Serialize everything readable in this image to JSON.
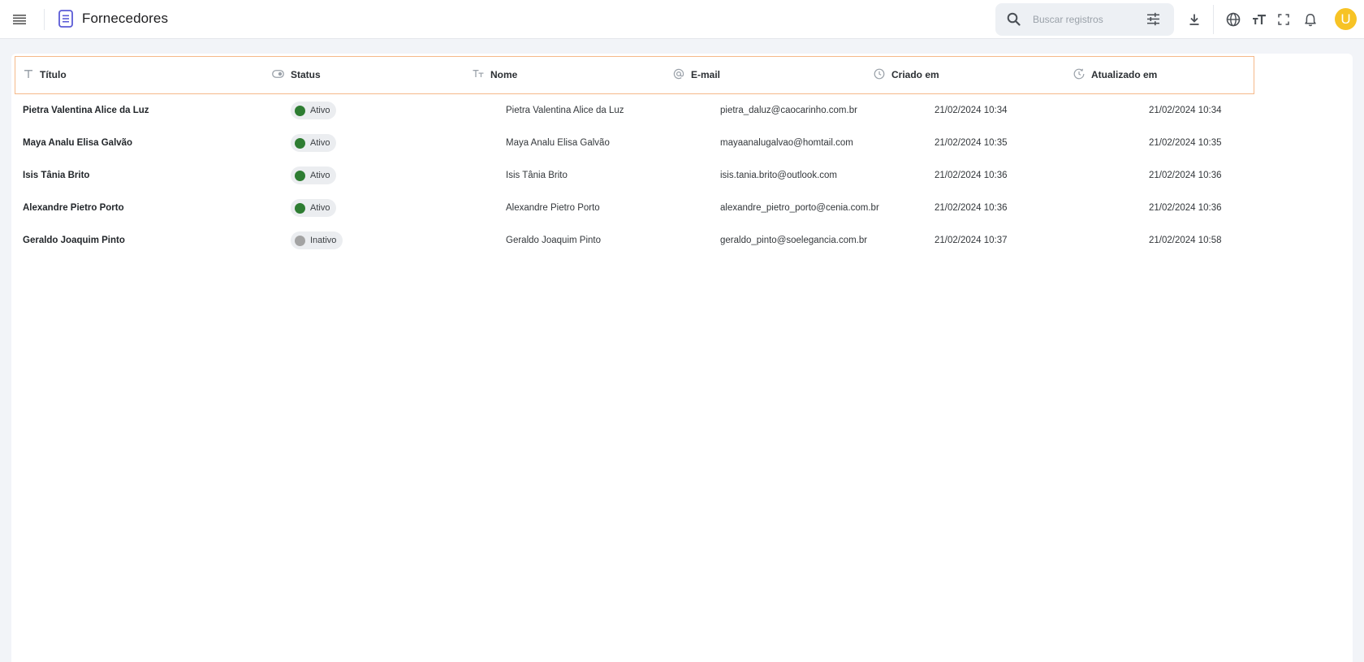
{
  "app": {
    "title": "Fornecedores"
  },
  "search": {
    "placeholder": "Buscar registros"
  },
  "user": {
    "avatar_initial": "U",
    "avatar_color": "#f7c325"
  },
  "toolbar_icons": [
    "menu-icon",
    "document-icon",
    "search-icon",
    "filter-sliders-icon",
    "download-icon",
    "globe-icon",
    "text-size-icon",
    "fullscreen-icon",
    "bell-icon"
  ],
  "table": {
    "columns": [
      {
        "label": "Título",
        "icon": "text-icon"
      },
      {
        "label": "Status",
        "icon": "toggle-icon"
      },
      {
        "label": "Nome",
        "icon": "text-size-icon"
      },
      {
        "label": "E-mail",
        "icon": "at-icon"
      },
      {
        "label": "Criado em",
        "icon": "clock-icon"
      },
      {
        "label": "Atualizado em",
        "icon": "clock-refresh-icon"
      }
    ],
    "rows": [
      {
        "titulo": "Pietra Valentina Alice da Luz",
        "status": "Ativo",
        "nome": "Pietra Valentina Alice da Luz",
        "email": "pietra_daluz@caocarinho.com.br",
        "criado": "21/02/2024 10:34",
        "atualizado": "21/02/2024 10:34"
      },
      {
        "titulo": "Maya Analu Elisa Galvão",
        "status": "Ativo",
        "nome": "Maya Analu Elisa Galvão",
        "email": "mayaanalugalvao@homtail.com",
        "criado": "21/02/2024 10:35",
        "atualizado": "21/02/2024 10:35"
      },
      {
        "titulo": "Isis Tânia Brito",
        "status": "Ativo",
        "nome": "Isis Tânia Brito",
        "email": "isis.tania.brito@outlook.com",
        "criado": "21/02/2024 10:36",
        "atualizado": "21/02/2024 10:36"
      },
      {
        "titulo": "Alexandre Pietro Porto",
        "status": "Ativo",
        "nome": "Alexandre Pietro Porto",
        "email": "alexandre_pietro_porto@cenia.com.br",
        "criado": "21/02/2024 10:36",
        "atualizado": "21/02/2024 10:36"
      },
      {
        "titulo": "Geraldo Joaquim Pinto",
        "status": "Inativo",
        "nome": "Geraldo Joaquim Pinto",
        "email": "geraldo_pinto@soelegancia.com.br",
        "criado": "21/02/2024 10:37",
        "atualizado": "21/02/2024 10:58"
      }
    ]
  },
  "colors": {
    "status_active": "#2e7d32",
    "status_inactive": "#a3a3a3",
    "header_highlight": "#f5b98a",
    "accent": "#5b5bd6"
  }
}
